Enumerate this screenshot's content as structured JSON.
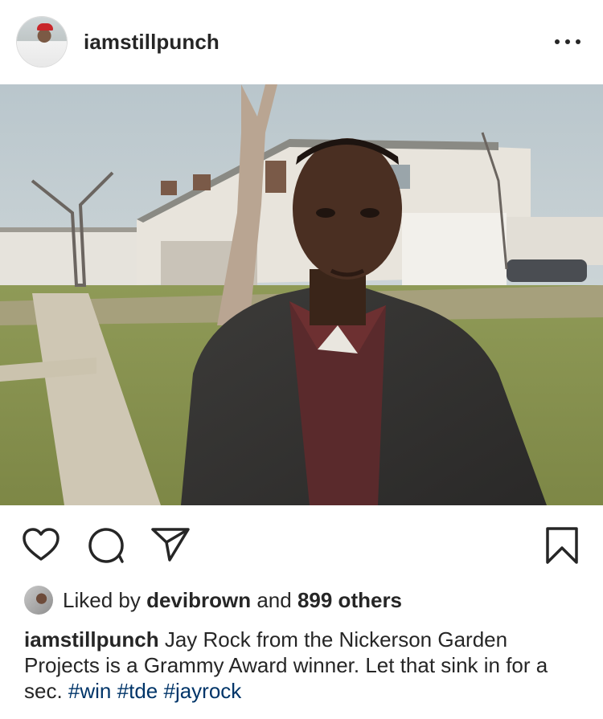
{
  "post": {
    "username": "iamstillpunch",
    "more_icon": "more-horizontal-icon",
    "photo_alt": "photo"
  },
  "actions": {
    "like_icon": "heart-icon",
    "comment_icon": "comment-icon",
    "share_icon": "send-icon",
    "save_icon": "bookmark-icon"
  },
  "likes": {
    "prefix": "Liked by",
    "liker": "devibrown",
    "conjunction": "and",
    "others": "899 others"
  },
  "caption": {
    "username": "iamstillpunch",
    "text": "Jay Rock from the Nickerson Garden Projects is a Grammy Award winner. Let that sink in for a sec.",
    "tags": [
      "#win",
      "#tde",
      "#jayrock"
    ]
  },
  "colors": {
    "text": "#262626",
    "hashtag": "#003569",
    "divider": "#dbdbdb"
  }
}
